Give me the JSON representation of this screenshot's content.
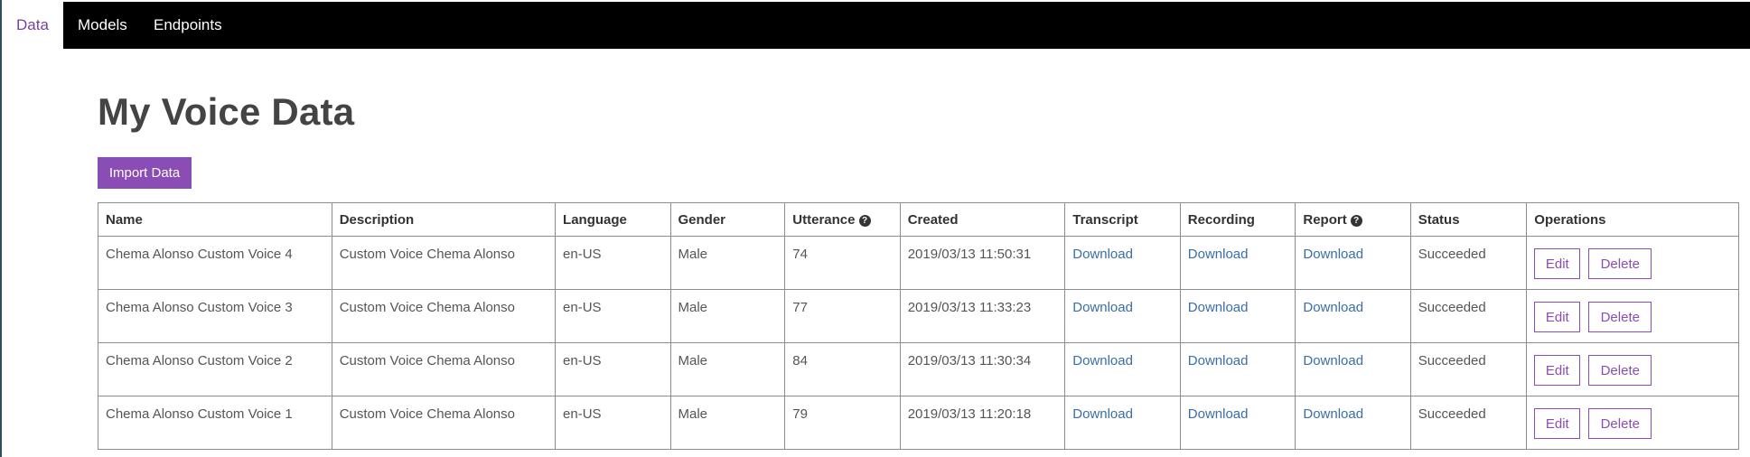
{
  "nav": {
    "tabs": [
      {
        "label": "Data"
      },
      {
        "label": "Models"
      },
      {
        "label": "Endpoints"
      }
    ]
  },
  "page": {
    "title": "My Voice Data",
    "import_button": "Import Data"
  },
  "table": {
    "headers": [
      "Name",
      "Description",
      "Language",
      "Gender",
      "Utterance",
      "Created",
      "Transcript",
      "Recording",
      "Report",
      "Status",
      "Operations"
    ],
    "info_icon_glyph": "?",
    "rows": [
      {
        "name": "Chema Alonso Custom Voice 4",
        "description": "Custom Voice Chema Alonso",
        "language": "en-US",
        "gender": "Male",
        "utterance": "74",
        "created": "2019/03/13 11:50:31",
        "transcript": "Download",
        "recording": "Download",
        "report": "Download",
        "status": "Succeeded",
        "edit": "Edit",
        "delete": "Delete"
      },
      {
        "name": "Chema Alonso Custom Voice 3",
        "description": "Custom Voice Chema Alonso",
        "language": "en-US",
        "gender": "Male",
        "utterance": "77",
        "created": "2019/03/13 11:33:23",
        "transcript": "Download",
        "recording": "Download",
        "report": "Download",
        "status": "Succeeded",
        "edit": "Edit",
        "delete": "Delete"
      },
      {
        "name": "Chema Alonso Custom Voice 2",
        "description": "Custom Voice Chema Alonso",
        "language": "en-US",
        "gender": "Male",
        "utterance": "84",
        "created": "2019/03/13 11:30:34",
        "transcript": "Download",
        "recording": "Download",
        "report": "Download",
        "status": "Succeeded",
        "edit": "Edit",
        "delete": "Delete"
      },
      {
        "name": "Chema Alonso Custom Voice 1",
        "description": "Custom Voice Chema Alonso",
        "language": "en-US",
        "gender": "Male",
        "utterance": "79",
        "created": "2019/03/13 11:20:18",
        "transcript": "Download",
        "recording": "Download",
        "report": "Download",
        "status": "Succeeded",
        "edit": "Edit",
        "delete": "Delete"
      }
    ]
  },
  "colors": {
    "accent": "#8a4db5",
    "link": "#3a6ea8",
    "nav_bg": "#000000"
  }
}
